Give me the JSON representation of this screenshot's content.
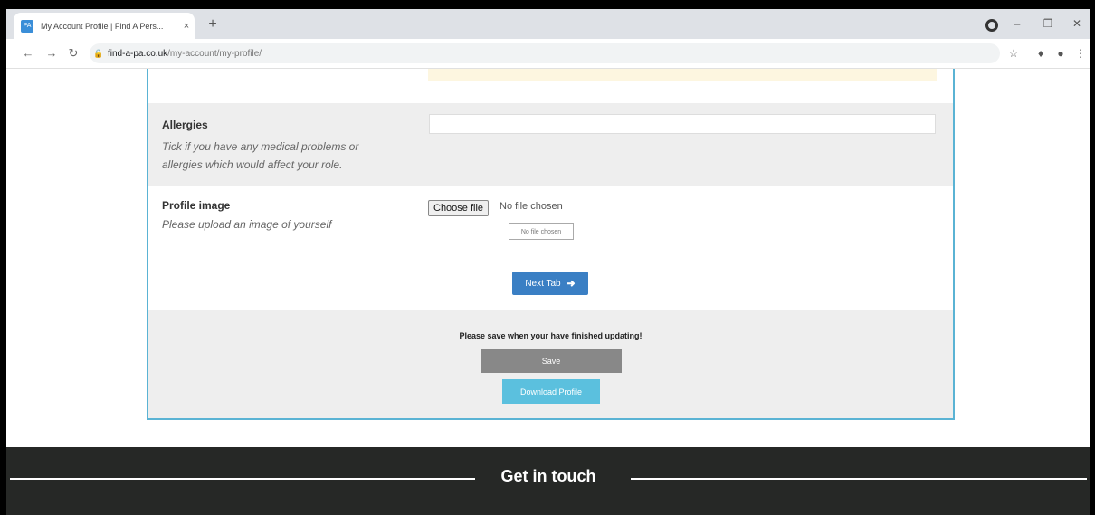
{
  "browser": {
    "tab_title": "My Account Profile | Find A Pers...",
    "favicon_text": "PA",
    "tab_close": "×",
    "new_tab": "+",
    "url_host": "find-a-pa.co.uk",
    "url_path": "/my-account/my-profile/"
  },
  "form": {
    "allergies": {
      "label": "Allergies",
      "help_line1": "Tick if you have any medical problems or",
      "help_line2": "allergies which would affect your role.",
      "value": ""
    },
    "profile_image": {
      "label": "Profile image",
      "help": "Please upload an image of yourself",
      "choose_label": "Choose file",
      "no_file": "No file chosen",
      "preview_text": "No file chosen"
    },
    "next_tab_label": "Next Tab"
  },
  "save_section": {
    "message": "Please save when your have finished updating!",
    "save_label": "Save",
    "download_label": "Download Profile"
  },
  "footer": {
    "title": "Get in touch"
  }
}
